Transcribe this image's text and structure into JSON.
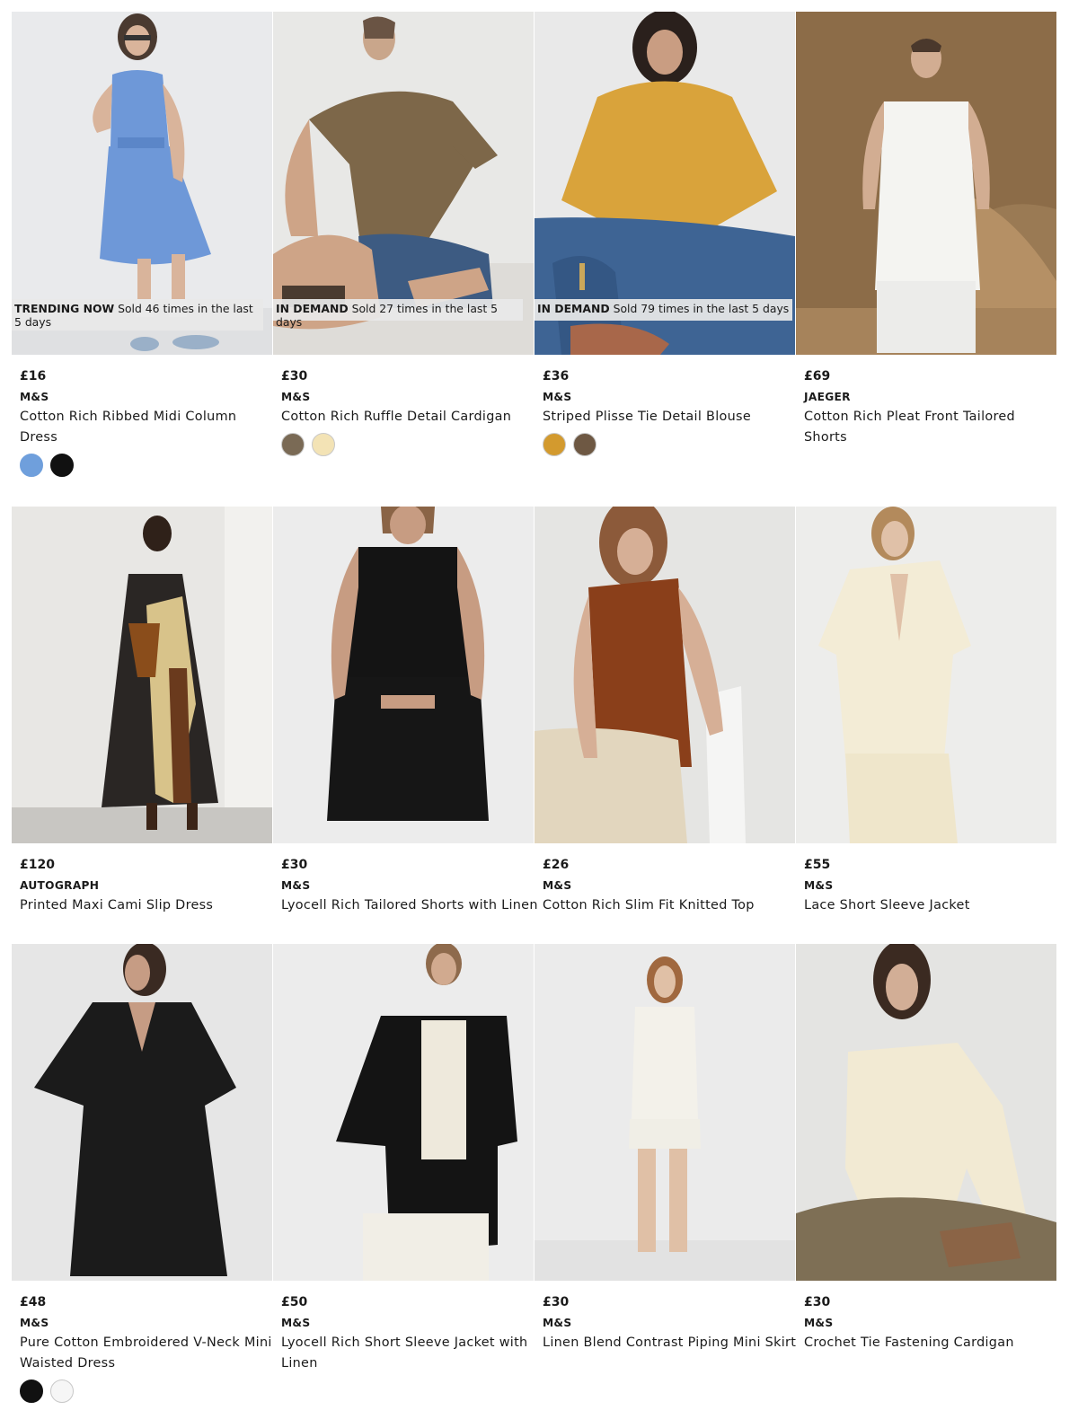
{
  "products": [
    {
      "badge_tag": "TRENDING NOW",
      "badge_text": "Sold 46 times in the last 5 days",
      "price": "£16",
      "brand": "M&S",
      "name": "Cotton Rich Ribbed Midi Column Dress",
      "swatches": [
        "#6f9fdc",
        "#111111"
      ]
    },
    {
      "badge_tag": "IN DEMAND",
      "badge_text": "Sold 27 times in the last 5 days",
      "price": "£30",
      "brand": "M&S",
      "name": "Cotton Rich Ruffle Detail Cardigan",
      "swatches": [
        "#7a6a55",
        "#f3e3b5"
      ]
    },
    {
      "badge_tag": "IN DEMAND",
      "badge_text": "Sold 79 times in the last 5 days",
      "price": "£36",
      "brand": "M&S",
      "name": "Striped Plisse Tie Detail Blouse",
      "swatches": [
        "#d39a2e",
        "#6e5843"
      ]
    },
    {
      "price": "£69",
      "brand": "JAEGER",
      "name": "Cotton Rich Pleat Front Tailored Shorts",
      "swatches": []
    },
    {
      "price": "£120",
      "brand": "AUTOGRAPH",
      "name": "Printed Maxi Cami Slip Dress",
      "swatches": []
    },
    {
      "price": "£30",
      "brand": "M&S",
      "name": "Lyocell Rich Tailored Shorts with Linen",
      "swatches": []
    },
    {
      "price": "£26",
      "brand": "M&S",
      "name": "Cotton Rich Slim Fit Knitted Top",
      "swatches": []
    },
    {
      "price": "£55",
      "brand": "M&S",
      "name": "Lace Short Sleeve Jacket",
      "swatches": []
    },
    {
      "price": "£48",
      "brand": "M&S",
      "name": "Pure Cotton Embroidered V-Neck Mini Waisted Dress",
      "swatches": [
        "#111111",
        "#f6f6f6"
      ]
    },
    {
      "price": "£50",
      "brand": "M&S",
      "name": "Lyocell Rich Short Sleeve Jacket with Linen",
      "swatches": []
    },
    {
      "price": "£30",
      "brand": "M&S",
      "name": "Linen Blend Contrast Piping Mini Skirt",
      "swatches": []
    },
    {
      "price": "£30",
      "brand": "M&S",
      "name": "Crochet Tie Fastening Cardigan",
      "swatches": []
    }
  ]
}
